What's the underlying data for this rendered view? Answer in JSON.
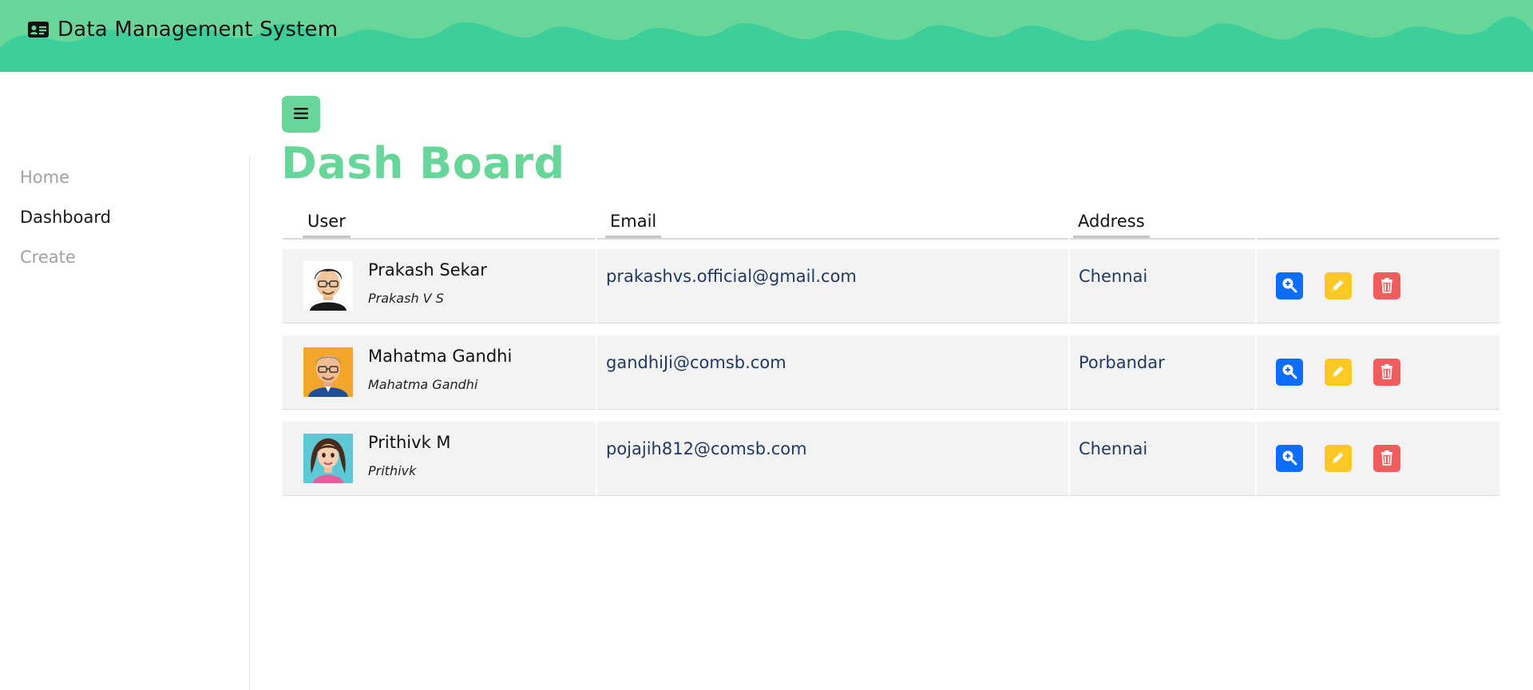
{
  "app": {
    "title": "Data Management System",
    "brand_icon": "id-card-icon"
  },
  "colors": {
    "accent": "#67d698",
    "wave_dark": "#3ccf9c",
    "view": "#0d6efd",
    "edit": "#ffc825",
    "delete": "#f25c5c",
    "cell_text": "#1e3a64"
  },
  "sidebar": {
    "items": [
      {
        "label": "Home",
        "active": false
      },
      {
        "label": "Dashboard",
        "active": true
      },
      {
        "label": "Create",
        "active": false
      }
    ]
  },
  "toolbar": {
    "menu_icon": "hamburger-icon"
  },
  "page": {
    "title": "Dash Board"
  },
  "table": {
    "headers": {
      "user": "User",
      "email": "Email",
      "address": "Address"
    },
    "rows": [
      {
        "name": "Prakash Sekar",
        "handle": "Prakash V S",
        "email": "prakashvs.official@gmail.com",
        "address": "Chennai",
        "avatar": "avatar-man-glasses"
      },
      {
        "name": "Mahatma Gandhi",
        "handle": "Mahatma Gandhi",
        "email": "gandhiJi@comsb.com",
        "address": "Porbandar",
        "avatar": "avatar-older-man"
      },
      {
        "name": "Prithivk M",
        "handle": "Prithivk",
        "email": "pojajih812@comsb.com",
        "address": "Chennai",
        "avatar": "avatar-woman"
      }
    ],
    "actions": {
      "view_icon": "zoom-in-icon",
      "edit_icon": "pencil-icon",
      "delete_icon": "trash-icon"
    }
  }
}
